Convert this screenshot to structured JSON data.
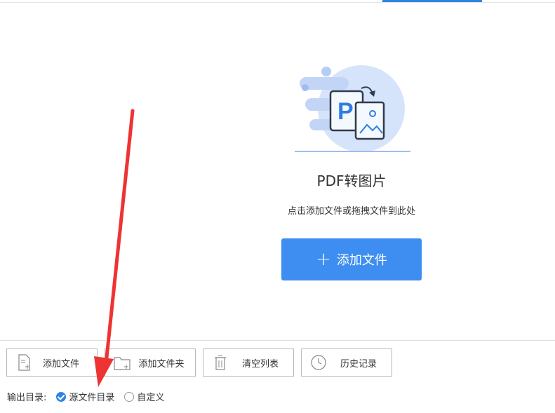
{
  "drop_area": {
    "title": "PDF转图片",
    "hint": "点击添加文件或拖拽文件到此处",
    "add_button": "添加文件",
    "badge_letter": "P"
  },
  "toolbar": {
    "add_file": "添加文件",
    "add_folder": "添加文件夹",
    "clear_list": "清空列表",
    "history": "历史记录"
  },
  "output": {
    "label": "输出目录:",
    "options": [
      {
        "label": "源文件目录",
        "selected": true
      },
      {
        "label": "自定义",
        "selected": false
      }
    ]
  },
  "colors": {
    "accent": "#2f83e6",
    "primary_button": "#3d8ef0",
    "annotation_arrow": "#ee3333"
  }
}
